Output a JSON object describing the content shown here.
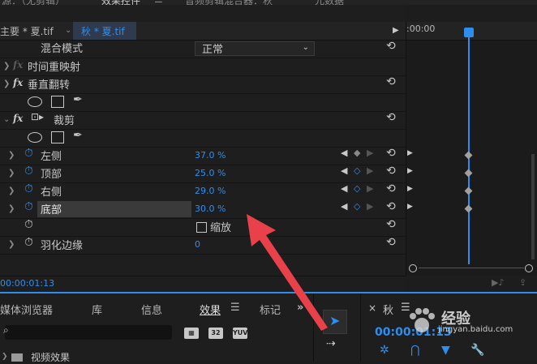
{
  "top_tabs": [
    "源：（无剪辑）",
    "效果控件",
    "☰",
    "音频剪辑混合器：秋",
    "元数据"
  ],
  "sequence": {
    "master": "主要 * 夏.tif",
    "clip": "秋 * 夏.tif"
  },
  "blend": {
    "label": "混合模式",
    "value": "正常"
  },
  "time_remap": "时间重映射",
  "effects": {
    "vflip": "垂直翻转",
    "crop": "裁剪"
  },
  "fx_label": "fx",
  "crop_params": [
    {
      "label": "左侧",
      "value": "37.0 %"
    },
    {
      "label": "顶部",
      "value": "25.0 %"
    },
    {
      "label": "右侧",
      "value": "29.0 %"
    },
    {
      "label": "底部",
      "value": "30.0 %"
    }
  ],
  "zoom": {
    "label": "缩放",
    "checked": false
  },
  "feather": {
    "label": "羽化边缘",
    "value": "0"
  },
  "timecode_ruler": ":00:00",
  "timecode_status": "00:00:01:13",
  "bottom_tabs": [
    "媒体浏览器",
    "库",
    "信息",
    "效果",
    "☰",
    "标记",
    "»"
  ],
  "bottom_tool_labels": [
    "32",
    "YUV"
  ],
  "bin_item": "视频效果",
  "program": {
    "tab": "秋",
    "timecode": "00:00:01:13"
  },
  "watermark": {
    "text": "经验",
    "url": "jingyan.baidu.com"
  },
  "colors": {
    "accent": "#2e8ef0",
    "arrow": "#e8414a",
    "bg": "#1e1e1e"
  }
}
